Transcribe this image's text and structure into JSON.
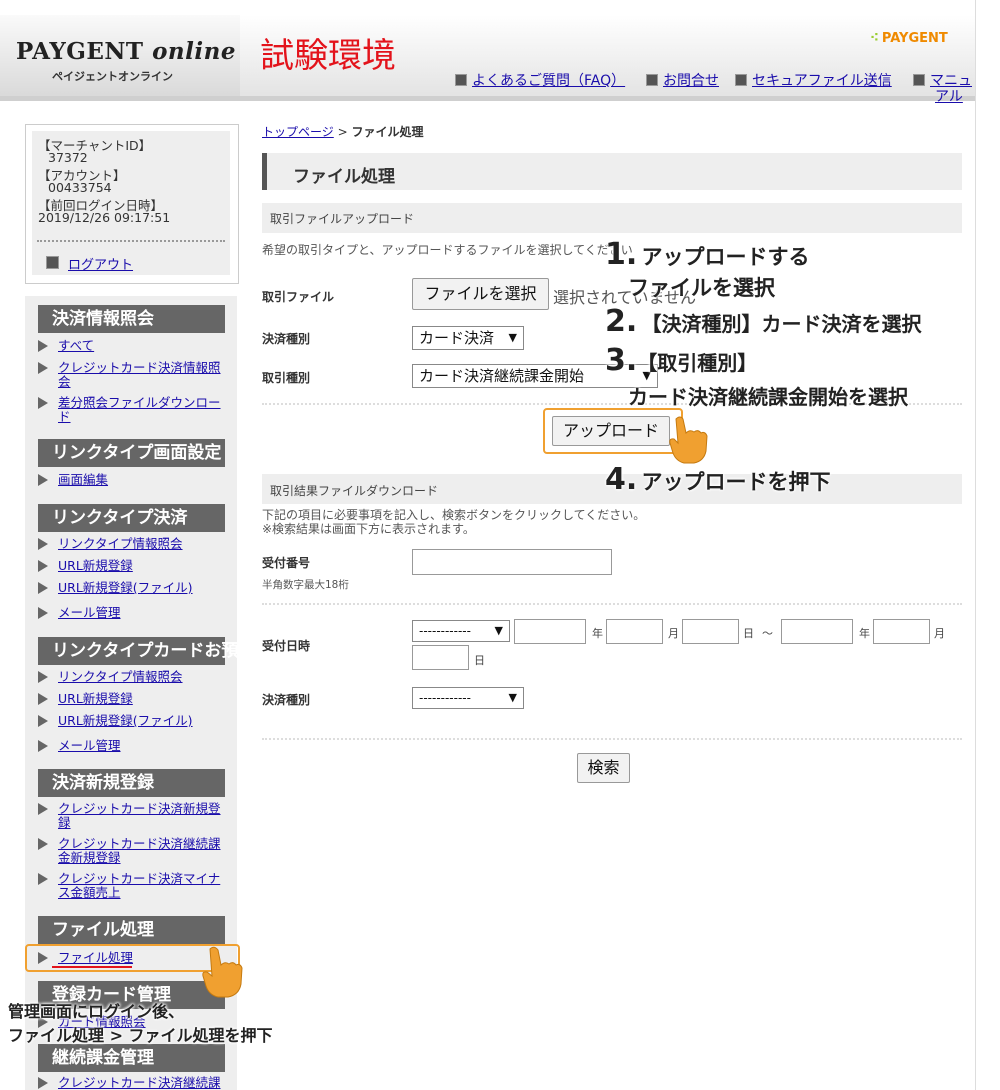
{
  "header": {
    "logo_main": "PAYGENT",
    "logo_italic": "online",
    "logo_sub": "ペイジェントオンライン",
    "environment": "試験環境",
    "brand": "PAYGENT",
    "links": [
      {
        "label": "よくあるご質問（FAQ）"
      },
      {
        "label": "お問合せ"
      },
      {
        "label": "セキュアファイル送信"
      },
      {
        "label": "マニュ"
      },
      {
        "label": "アル"
      }
    ]
  },
  "account": {
    "merchant_id_label": "【マーチャントID】",
    "merchant_id": "37372",
    "account_label": "【アカウント】",
    "account": "00433754",
    "last_login_label": "【前回ログイン日時】",
    "last_login": "2019/12/26 09:17:51",
    "logout": "ログアウト"
  },
  "sidebar": {
    "sections": [
      {
        "title": "決済情報照会",
        "items": [
          "すべて",
          "クレジットカード決済情報照",
          "会",
          "差分照会ファイルダウンロー",
          "ド"
        ]
      },
      {
        "title": "リンクタイプ画面設定",
        "items": [
          "画面編集"
        ]
      },
      {
        "title": "リンクタイプ決済",
        "items": [
          "リンクタイプ情報照会",
          "URL新規登録",
          "URL新規登録(ファイル)",
          "メール管理"
        ]
      },
      {
        "title": "リンクタイプカードお預かり",
        "items": [
          "リンクタイプ情報照会",
          "URL新規登録",
          "URL新規登録(ファイル)",
          "メール管理"
        ]
      },
      {
        "title": "決済新規登録",
        "items": [
          "クレジットカード決済新規登",
          "録",
          "クレジットカード決済継続課",
          "金新規登録",
          "クレジットカード決済マイナ",
          "ス金額売上"
        ]
      },
      {
        "title": "ファイル処理",
        "items": [
          "ファイル処理"
        ]
      },
      {
        "title": "登録カード管理",
        "items": [
          "カード情報照会"
        ]
      },
      {
        "title": "継続課金管理",
        "items": [
          "クレジットカード決済継続課"
        ]
      }
    ]
  },
  "breadcrumb": {
    "home": "トップページ",
    "sep": " > ",
    "current": "ファイル処理"
  },
  "page_title": "ファイル処理",
  "upload": {
    "section_title": "取引ファイルアップロード",
    "note": "希望の取引タイプと、アップロードするファイルを選択してください",
    "file_label": "取引ファイル",
    "file_button": "ファイルを選択",
    "file_status": "選択されていません",
    "payment_type_label": "決済種別",
    "payment_type_value": "カード決済",
    "trade_type_label": "取引種別",
    "trade_type_value": "カード決済継続課金開始",
    "upload_button": "アップロード"
  },
  "download": {
    "section_title": "取引結果ファイルダウンロード",
    "note1": "下記の項目に必要事項を記入し、検索ボタンをクリックしてください。",
    "note2": "※検索結果は画面下方に表示されます。",
    "receipt_label": "受付番号",
    "receipt_hint": "半角数字最大18桁",
    "receipt_date_label": "受付日時",
    "date_select_value": "------------",
    "year": "年",
    "month": "月",
    "day": "日",
    "tilde": "～",
    "payment_type_label": "決済種別",
    "payment_type_value": "------------",
    "search_button": "検索"
  },
  "annotations": {
    "step1_num": "1.",
    "step1_a": "アップロードする",
    "step1_b": "ファイルを選択",
    "step2_num": "2.",
    "step2": "【決済種別】カード決済を選択",
    "step3_num": "3.",
    "step3_a": "【取引種別】",
    "step3_b": "カード決済継続課金開始を選択",
    "step4_num": "4.",
    "step4": "アップロードを押下",
    "login_a": "管理画面にログイン後、",
    "login_b": "ファイル処理 > ファイル処理を押下",
    "accent_color": "#f0a030"
  }
}
